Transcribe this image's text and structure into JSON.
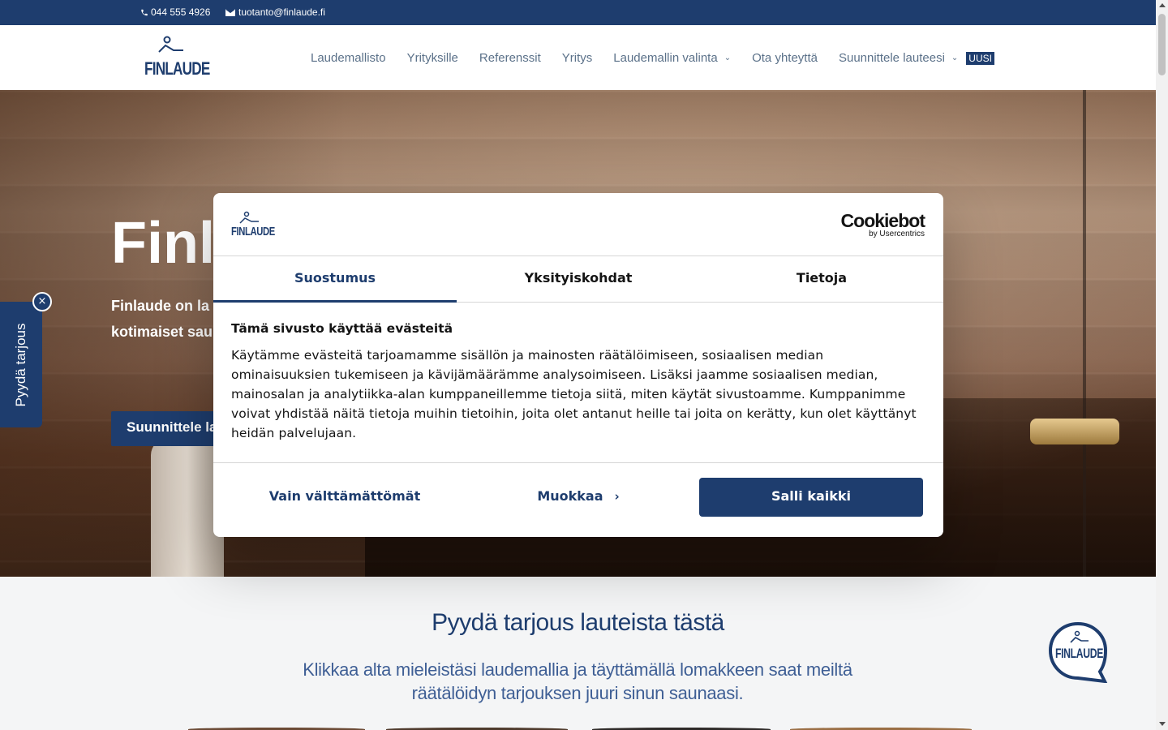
{
  "topbar": {
    "phone": "044 555 4926",
    "email": "tuotanto@finlaude.fi"
  },
  "header": {
    "logo_text": "FINLAUDE",
    "nav": [
      {
        "label": "Laudemallisto"
      },
      {
        "label": "Yrityksille"
      },
      {
        "label": "Referenssit"
      },
      {
        "label": "Yritys"
      },
      {
        "label": "Laudemallin valinta"
      },
      {
        "label": "Ota yhteyttä"
      },
      {
        "label": "Suunnittele lauteesi"
      }
    ],
    "nav_badge": "UUSI"
  },
  "hero": {
    "title_visible": "Finl",
    "subtitle_line1": "Finlaude on la",
    "subtitle_line2": "kotimaiset sau",
    "cta_label": "Suunnittele la"
  },
  "side_tab": {
    "label": "Pyydä tarjous",
    "close_glyph": "×"
  },
  "section": {
    "heading": "Pyydä tarjous lauteista tästä",
    "intro": "Klikkaa alta mieleistäsi laudemallia ja täyttämällä lomakkeen saat meiltä räätälöidyn tarjouksen juuri sinun saunaasi."
  },
  "chat_widget": {
    "logo_text": "FINLAUDE"
  },
  "cookie_dialog": {
    "logo_text": "FINLAUDE",
    "cookiebot_brand": "Cookiebot",
    "cookiebot_by": "by Usercentrics",
    "tabs": [
      {
        "label": "Suostumus",
        "active": true
      },
      {
        "label": "Yksityiskohdat",
        "active": false
      },
      {
        "label": "Tietoja",
        "active": false
      }
    ],
    "heading": "Tämä sivusto käyttää evästeitä",
    "body": "Käytämme evästeitä tarjoamamme sisällön ja mainosten räätälöimiseen, sosiaalisen median ominaisuuksien tukemiseen ja kävijämäärämme analysoimiseen. Lisäksi jaamme sosiaalisen median, mainosalan ja analytiikka-alan kumppaneillemme tietoja siitä, miten käytät sivustoamme. Kumppanimme voivat yhdistää näitä tietoja muihin tietoihin, joita olet antanut heille tai joita on kerätty, kun olet käyttänyt heidän palvelujaan.",
    "buttons": {
      "necessary": "Vain välttämättömät",
      "customize": "Muokkaa",
      "allow_all": "Salli kaikki"
    }
  },
  "colors": {
    "brand_navy": "#1e3d6e",
    "nav_text": "#5b7189",
    "section_text": "#3f5f95"
  },
  "icons": {
    "phone": "phone-icon",
    "email": "mail-icon",
    "chevron": "chevron-down-icon",
    "arrow": "chevron-right-icon"
  }
}
